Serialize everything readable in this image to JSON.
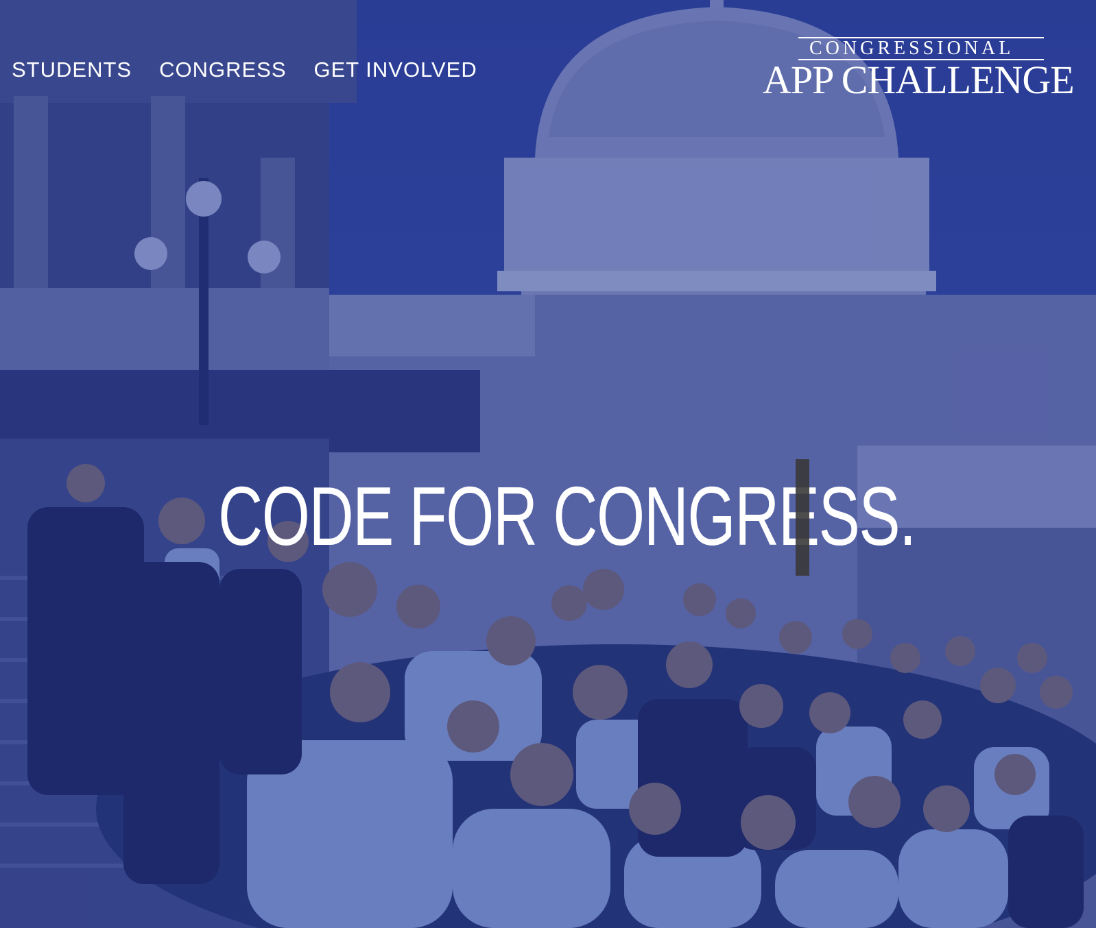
{
  "nav": {
    "items": [
      "STUDENTS",
      "CONGRESS",
      "GET INVOLVED"
    ]
  },
  "logo": {
    "line1": "CONGRESSIONAL",
    "line2": "APP CHALLENGE"
  },
  "hero": {
    "headline": "CODE FOR CONGRESS."
  },
  "colors": {
    "overlay": "#2e3f93",
    "text": "#ffffff",
    "shirt": "#9cb3dd"
  }
}
